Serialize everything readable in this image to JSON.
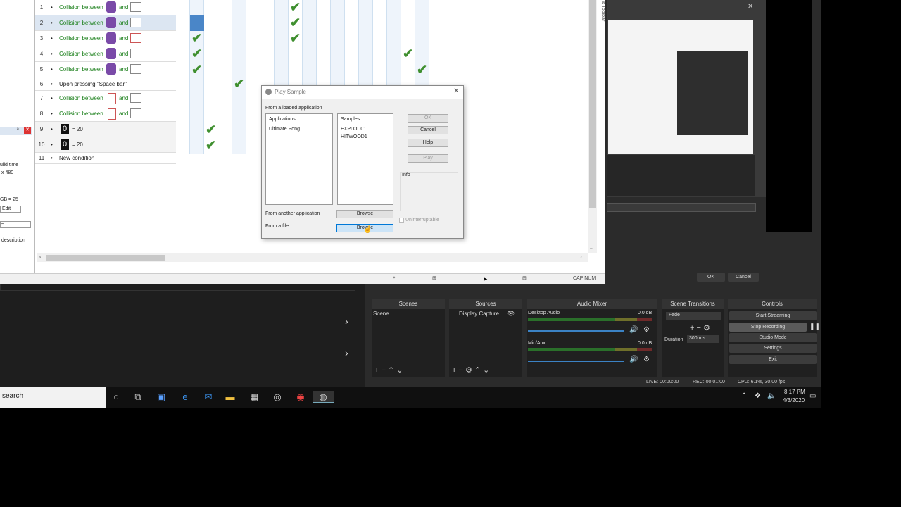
{
  "editor": {
    "rows": [
      {
        "num": "1",
        "text": "Collision between",
        "and": "and"
      },
      {
        "num": "2",
        "text": "Collision between",
        "and": "and"
      },
      {
        "num": "3",
        "text": "Collision between",
        "and": "and"
      },
      {
        "num": "4",
        "text": "Collision between",
        "and": "and"
      },
      {
        "num": "5",
        "text": "Collision between",
        "and": "and"
      },
      {
        "num": "6",
        "text": "Upon pressing \"Space bar\""
      },
      {
        "num": "7",
        "text": "Collision between",
        "and": "and"
      },
      {
        "num": "8",
        "text": "Collision between",
        "and": "and"
      },
      {
        "num": "9",
        "text": "= 20"
      },
      {
        "num": "10",
        "text": "= 20"
      },
      {
        "num": "11",
        "text": "New condition"
      }
    ],
    "left_fragments": [
      "uild time",
      "x 480",
      "GB = 25",
      "Edit",
      "e",
      "description"
    ],
    "status": "CAP NUM",
    "side_label": "s Toolbar"
  },
  "dialog": {
    "title": "Play Sample",
    "from_loaded": "From a loaded application",
    "apps_header": "Applications",
    "apps": [
      "Ultimate Pong"
    ],
    "samples_header": "Samples",
    "samples": [
      "EXPLOD01",
      "HITWOOD1"
    ],
    "ok": "OK",
    "cancel": "Cancel",
    "help": "Help",
    "play": "Play",
    "info": "Info",
    "from_another": "From another application",
    "browse1": "Browse",
    "uninterruptable": "Uninterruptable",
    "from_file": "From a file",
    "browse2": "Browse"
  },
  "obs": {
    "ok": "OK",
    "cancel": "Cancel",
    "docks": {
      "scenes": "Scenes",
      "sources": "Sources",
      "audio_mixer": "Audio Mixer",
      "transitions": "Scene Transitions",
      "controls": "Controls"
    },
    "scene_item": "Scene",
    "source_item": "Display Capture",
    "desktop_audio": "Desktop Audio",
    "desktop_db": "0.0 dB",
    "mic_aux": "Mic/Aux",
    "mic_db": "0.0 dB",
    "transition": "Fade",
    "duration_label": "Duration",
    "duration_value": "300 ms",
    "start_streaming": "Start Streaming",
    "stop_recording": "Stop Recording",
    "studio_mode": "Studio Mode",
    "settings": "Settings",
    "exit": "Exit",
    "live": "LIVE: 00:00:00",
    "rec": "REC: 00:01:00",
    "cpu": "CPU: 6.1%, 30.00 fps"
  },
  "taskbar": {
    "search": "search",
    "time": "8:17 PM",
    "date": "4/3/2020"
  }
}
